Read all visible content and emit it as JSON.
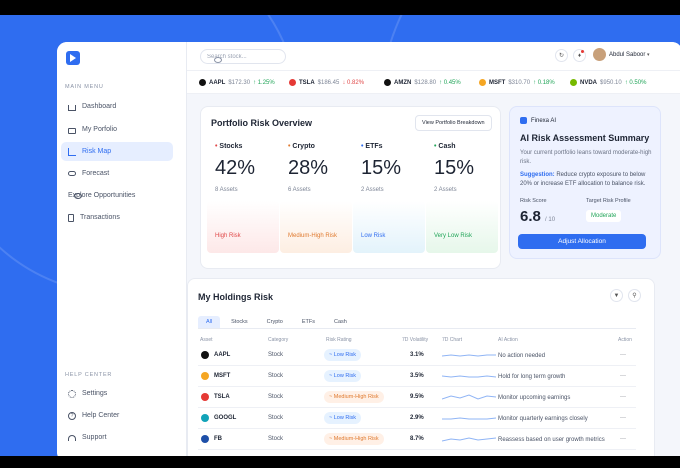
{
  "search": {
    "placeholder": "Search stock..."
  },
  "user": {
    "name": "Abdul Saboor"
  },
  "sidebar": {
    "main_label": "MAIN MENU",
    "items": [
      {
        "label": "Dashboard",
        "icon": "home-icon"
      },
      {
        "label": "My Porfolio",
        "icon": "briefcase-icon"
      },
      {
        "label": "Risk Map",
        "icon": "chart-icon"
      },
      {
        "label": "Forecast",
        "icon": "cloud-icon"
      },
      {
        "label": "Explore Opportunities",
        "icon": "search-icon"
      },
      {
        "label": "Transactions",
        "icon": "document-icon"
      }
    ],
    "help_label": "HELP CENTER",
    "help_items": [
      {
        "label": "Settings",
        "icon": "gear-icon"
      },
      {
        "label": "Help Center",
        "icon": "help-icon"
      },
      {
        "label": "Support",
        "icon": "headset-icon"
      }
    ]
  },
  "ticker": [
    {
      "sym": "AAPL",
      "price": "$172.30",
      "change": "1.25%",
      "dir": "up",
      "color": "#111111"
    },
    {
      "sym": "TSLA",
      "price": "$186.45",
      "change": "0.82%",
      "dir": "down",
      "color": "#e53935"
    },
    {
      "sym": "AMZN",
      "price": "$128.80",
      "change": "0.45%",
      "dir": "up",
      "color": "#111111"
    },
    {
      "sym": "MSFT",
      "price": "$310.70",
      "change": "0.18%",
      "dir": "up",
      "color": "#f5a623"
    },
    {
      "sym": "NVDA",
      "price": "$950.10",
      "change": "0.50%",
      "dir": "up",
      "color": "#76b900"
    }
  ],
  "risk_overview": {
    "title": "Portfolio Risk Overview",
    "button": "View Portfolio Breakdown",
    "columns": [
      {
        "name": "Stocks",
        "pct": "42%",
        "assets": "8 Assets",
        "risk": "High Risk",
        "color": "#e04848",
        "grad": "#fde8e8"
      },
      {
        "name": "Crypto",
        "pct": "28%",
        "assets": "6 Assets",
        "risk": "Medium-High Risk",
        "color": "#e07a2f",
        "grad": "#fdeee2"
      },
      {
        "name": "ETFs",
        "pct": "15%",
        "assets": "2 Assets",
        "risk": "Low Risk",
        "color": "#2f6df0",
        "grad": "#e3f3fb"
      },
      {
        "name": "Cash",
        "pct": "15%",
        "assets": "2 Assets",
        "risk": "Very Low Risk",
        "color": "#22a559",
        "grad": "#e6f7ea"
      }
    ]
  },
  "ai": {
    "badge": "Finexa AI",
    "title": "AI Risk Assessment Summary",
    "desc": "Your current portfolio leans toward moderate-high risk.",
    "sugg_label": "Suggestion:",
    "sugg": "Reduce crypto exposure to below 20% or increase ETF allocation to balance risk.",
    "score_label": "Risk Score",
    "score": "6.8",
    "score_max": "/ 10",
    "profile_label": "Target Risk Profile",
    "profile": "Moderate",
    "button": "Adjust Allocation"
  },
  "holdings": {
    "title": "My Holdings Risk",
    "tabs": [
      "All",
      "Stocks",
      "Crypto",
      "ETFs",
      "Cash"
    ],
    "headers": [
      "Asset",
      "Category",
      "Risk Rating",
      "7D Volatility",
      "7D Chart",
      "AI Action",
      "Action"
    ],
    "rows": [
      {
        "asset": "AAPL",
        "color": "#111111",
        "category": "Stock",
        "risk": "Low Risk",
        "level": "low",
        "vol": "3.1%",
        "action": "No action needed",
        "trend": [
          4,
          5,
          4,
          5,
          4,
          5,
          5
        ]
      },
      {
        "asset": "MSFT",
        "color": "#f5a623",
        "category": "Stock",
        "risk": "Low Risk",
        "level": "low",
        "vol": "3.5%",
        "action": "Hold for long term growth",
        "trend": [
          5,
          4,
          5,
          4,
          4,
          5,
          4
        ]
      },
      {
        "asset": "TSLA",
        "color": "#e53935",
        "category": "Stock",
        "risk": "Medium-High Risk",
        "level": "med",
        "vol": "9.5%",
        "action": "Monitor upcoming earnings",
        "trend": [
          3,
          6,
          4,
          7,
          3,
          6,
          5
        ]
      },
      {
        "asset": "GOOGL",
        "color": "#12a3b8",
        "category": "Stock",
        "risk": "Low Risk",
        "level": "low",
        "vol": "2.9%",
        "action": "Monitor quarterly earnings closely",
        "trend": [
          4,
          4,
          5,
          4,
          4,
          4,
          5
        ]
      },
      {
        "asset": "FB",
        "color": "#1e4fa8",
        "category": "Stock",
        "risk": "Medium-High Risk",
        "level": "med",
        "vol": "8.7%",
        "action": "Reassess based on user growth metrics",
        "trend": [
          3,
          5,
          4,
          6,
          4,
          5,
          6
        ]
      }
    ]
  }
}
